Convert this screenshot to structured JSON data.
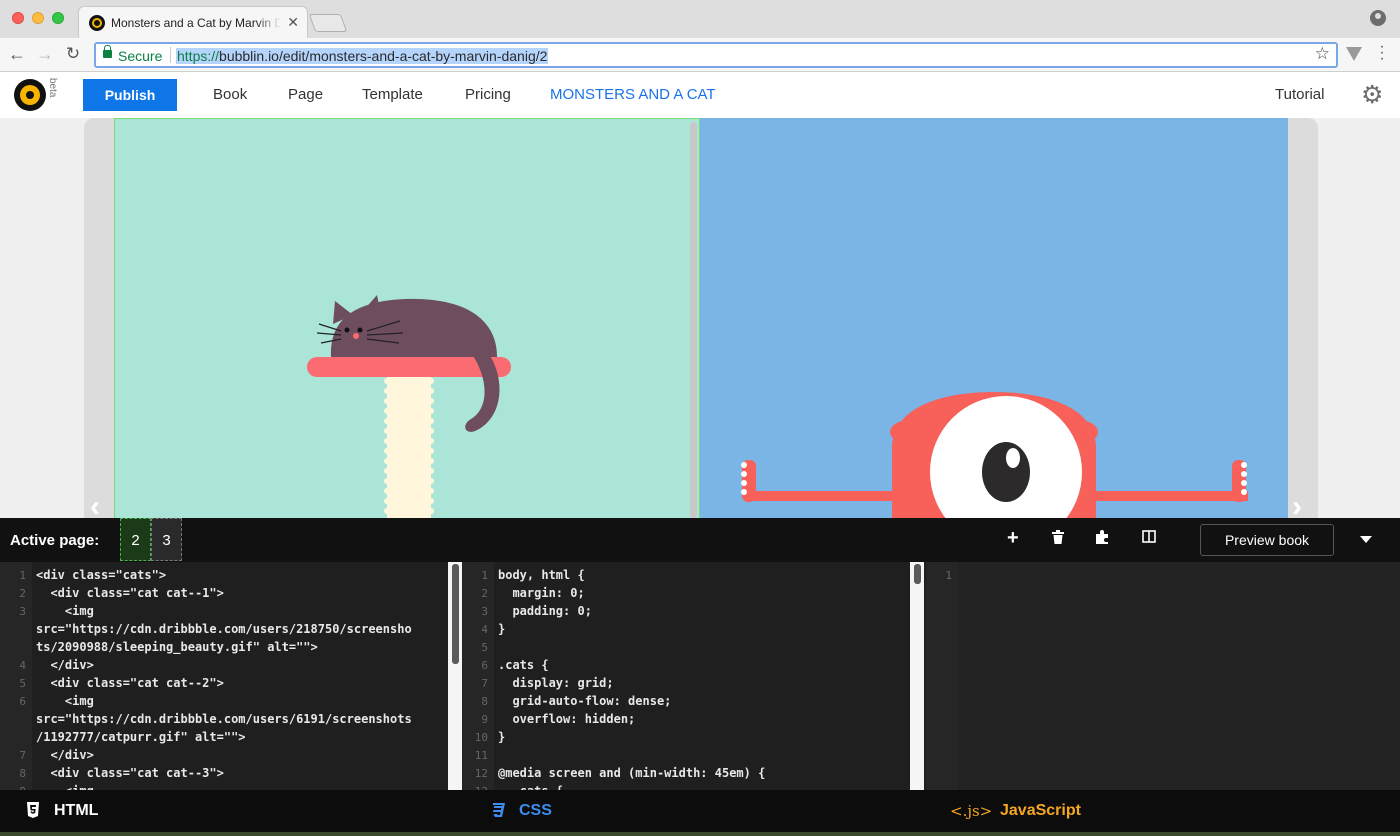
{
  "browser": {
    "tab_title": "Monsters and a Cat by Marvin Danig",
    "secure_label": "Secure",
    "url_scheme": "https://",
    "url_rest": "bubblin.io/edit/monsters-and-a-cat-by-marvin-danig/2"
  },
  "header": {
    "beta": "beta",
    "publish": "Publish",
    "nav": [
      "Book",
      "Page",
      "Template",
      "Pricing"
    ],
    "book_title": "MONSTERS AND A CAT",
    "tutorial": "Tutorial"
  },
  "editor": {
    "active_page_label": "Active page:",
    "pages": [
      "2",
      "3"
    ],
    "preview": "Preview book"
  },
  "code": {
    "html_lines": [
      {
        "n": "1",
        "t": "<div class=\"cats\">"
      },
      {
        "n": "2",
        "t": "  <div class=\"cat cat--1\">"
      },
      {
        "n": "3",
        "t": "    <img"
      },
      {
        "n": "",
        "t": "src=\"https://cdn.dribbble.com/users/218750/screensho"
      },
      {
        "n": "",
        "t": "ts/2090988/sleeping_beauty.gif\" alt=\"\">"
      },
      {
        "n": "4",
        "t": "  </div>"
      },
      {
        "n": "5",
        "t": "  <div class=\"cat cat--2\">"
      },
      {
        "n": "6",
        "t": "    <img"
      },
      {
        "n": "",
        "t": "src=\"https://cdn.dribbble.com/users/6191/screenshots"
      },
      {
        "n": "",
        "t": "/1192777/catpurr.gif\" alt=\"\">"
      },
      {
        "n": "7",
        "t": "  </div>"
      },
      {
        "n": "8",
        "t": "  <div class=\"cat cat--3\">"
      },
      {
        "n": "9",
        "t": "    <img"
      }
    ],
    "css_lines": [
      {
        "n": "1",
        "t": "body, html {"
      },
      {
        "n": "2",
        "t": "  margin: 0;"
      },
      {
        "n": "3",
        "t": "  padding: 0;"
      },
      {
        "n": "4",
        "t": "}"
      },
      {
        "n": "5",
        "t": ""
      },
      {
        "n": "6",
        "t": ".cats {"
      },
      {
        "n": "7",
        "t": "  display: grid;"
      },
      {
        "n": "8",
        "t": "  grid-auto-flow: dense;"
      },
      {
        "n": "9",
        "t": "  overflow: hidden;"
      },
      {
        "n": "10",
        "t": "}"
      },
      {
        "n": "11",
        "t": ""
      },
      {
        "n": "12",
        "t": "@media screen and (min-width: 45em) {"
      },
      {
        "n": "13",
        "t": "  .cats {"
      }
    ],
    "js_lines": [
      {
        "n": "1",
        "t": ""
      }
    ]
  },
  "footer": {
    "html": "HTML",
    "css": "CSS",
    "js_icon": "<.js>",
    "js": "JavaScript"
  },
  "colors": {
    "publish": "#0f76e8",
    "title_link": "#1a73e8",
    "page_left_bg": "#abe5d8",
    "page_right_bg": "#7bb5e6",
    "monster": "#f7615a",
    "cat": "#6e4e5e"
  }
}
